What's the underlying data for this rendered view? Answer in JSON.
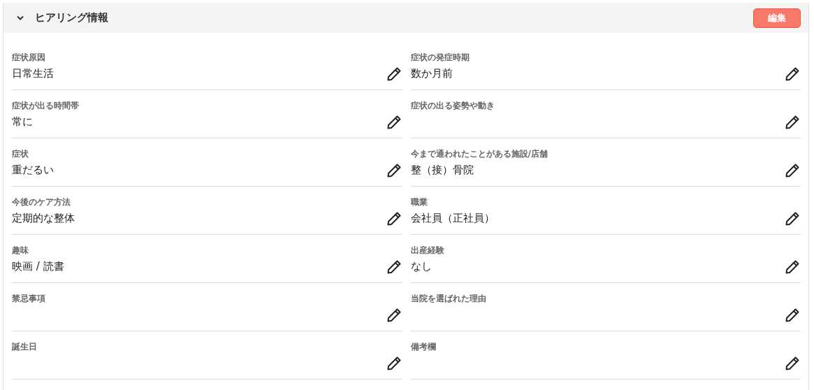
{
  "section": {
    "title": "ヒアリング情報",
    "expanded": true,
    "edit_button": "編集"
  },
  "fields": [
    {
      "label": "症状原因",
      "value": "日常生活"
    },
    {
      "label": "症状の発症時期",
      "value": "数か月前"
    },
    {
      "label": "症状が出る時間帯",
      "value": "常に"
    },
    {
      "label": "症状の出る姿勢や動き"
    },
    {
      "label": "症状",
      "value": "重だるい"
    },
    {
      "label": "今まで通われたことがある施設/店舗",
      "value": "整（接）骨院"
    },
    {
      "label": "今後のケア方法",
      "value": "定期的な整体"
    },
    {
      "label": "職業",
      "value": "会社員（正社員）"
    },
    {
      "label": "趣味",
      "value": "映画 / 読書"
    },
    {
      "label": "出産経験",
      "value": "なし"
    },
    {
      "label": "禁忌事項"
    },
    {
      "label": "当院を選ばれた理由"
    },
    {
      "label": "誕生日"
    },
    {
      "label": "備考欄"
    }
  ]
}
